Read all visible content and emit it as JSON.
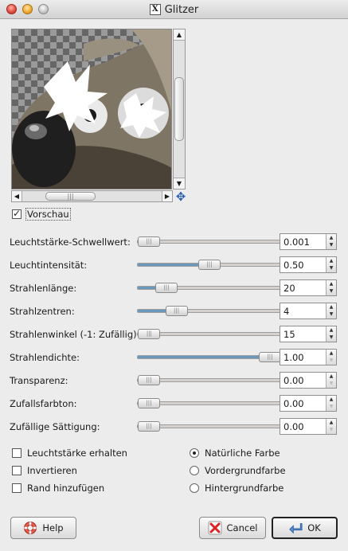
{
  "window": {
    "title": "Glitzer"
  },
  "preview_toggle": {
    "label": "Vorschau",
    "checked": true
  },
  "params": [
    {
      "label": "Leuchtstärke-Schwellwert:",
      "value": "0.001",
      "level": 0.0
    },
    {
      "label": "Leuchtintensität:",
      "value": "0.50",
      "level": 0.5
    },
    {
      "label": "Strahlenlänge:",
      "value": "20",
      "level": 0.2
    },
    {
      "label": "Strahlzentren:",
      "value": "4",
      "level": 0.27
    },
    {
      "label": "Strahlenwinkel (-1: Zufällig)",
      "value": "15",
      "level": 0.08
    },
    {
      "label": "Strahlendichte:",
      "value": "1.00",
      "level": 1.0
    },
    {
      "label": "Transparenz:",
      "value": "0.00",
      "level": 0.0
    },
    {
      "label": "Zufallsfarbton:",
      "value": "0.00",
      "level": 0.0
    },
    {
      "label": "Zufällige Sättigung:",
      "value": "0.00",
      "level": 0.0
    }
  ],
  "options": {
    "checkboxes": [
      {
        "label": "Leuchtstärke erhalten",
        "checked": false
      },
      {
        "label": "Invertieren",
        "checked": false
      },
      {
        "label": "Rand hinzufügen",
        "checked": false
      }
    ],
    "radios": [
      {
        "label": "Natürliche Farbe",
        "selected": true
      },
      {
        "label": "Vordergrundfarbe",
        "selected": false
      },
      {
        "label": "Hintergrundfarbe",
        "selected": false
      }
    ]
  },
  "buttons": {
    "help": "Help",
    "cancel": "Cancel",
    "ok": "OK"
  },
  "colors": {
    "slider_fill": "#6a98bc",
    "window_bg": "#ececec"
  },
  "icons": {
    "help": "lifebuoy-icon",
    "cancel": "cancel-x-icon",
    "ok": "return-arrow-icon",
    "navigate": "navigate-cross-icon"
  }
}
